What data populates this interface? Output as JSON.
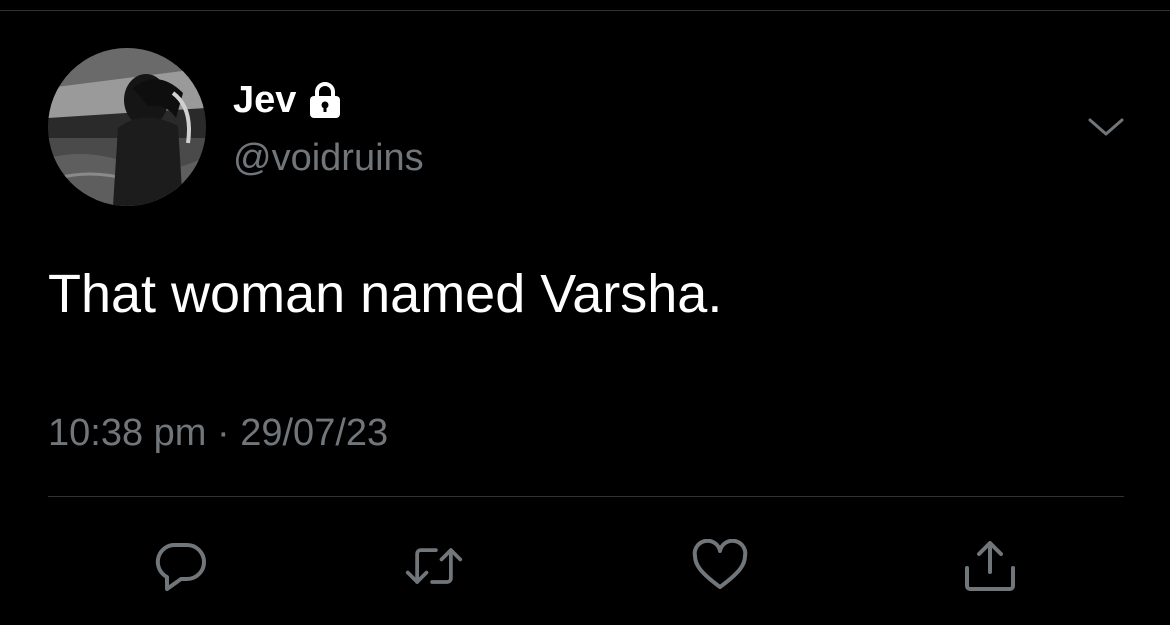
{
  "tweet": {
    "author": {
      "display_name": "Jev",
      "handle": "@voidruins",
      "protected_icon": "lock-icon",
      "avatar": "profile-photo"
    },
    "text": "That woman named Varsha.",
    "time": "10:38 pm",
    "separator": "·",
    "date": "29/07/23",
    "menu_icon": "chevron-down-icon"
  },
  "actions": [
    {
      "name": "reply",
      "icon": "reply-icon"
    },
    {
      "name": "retweet",
      "icon": "retweet-icon"
    },
    {
      "name": "like",
      "icon": "heart-icon"
    },
    {
      "name": "share",
      "icon": "share-icon"
    }
  ],
  "colors": {
    "background": "#000000",
    "primary_text": "#ffffff",
    "secondary_text": "#71767b",
    "divider": "#2f3336"
  }
}
